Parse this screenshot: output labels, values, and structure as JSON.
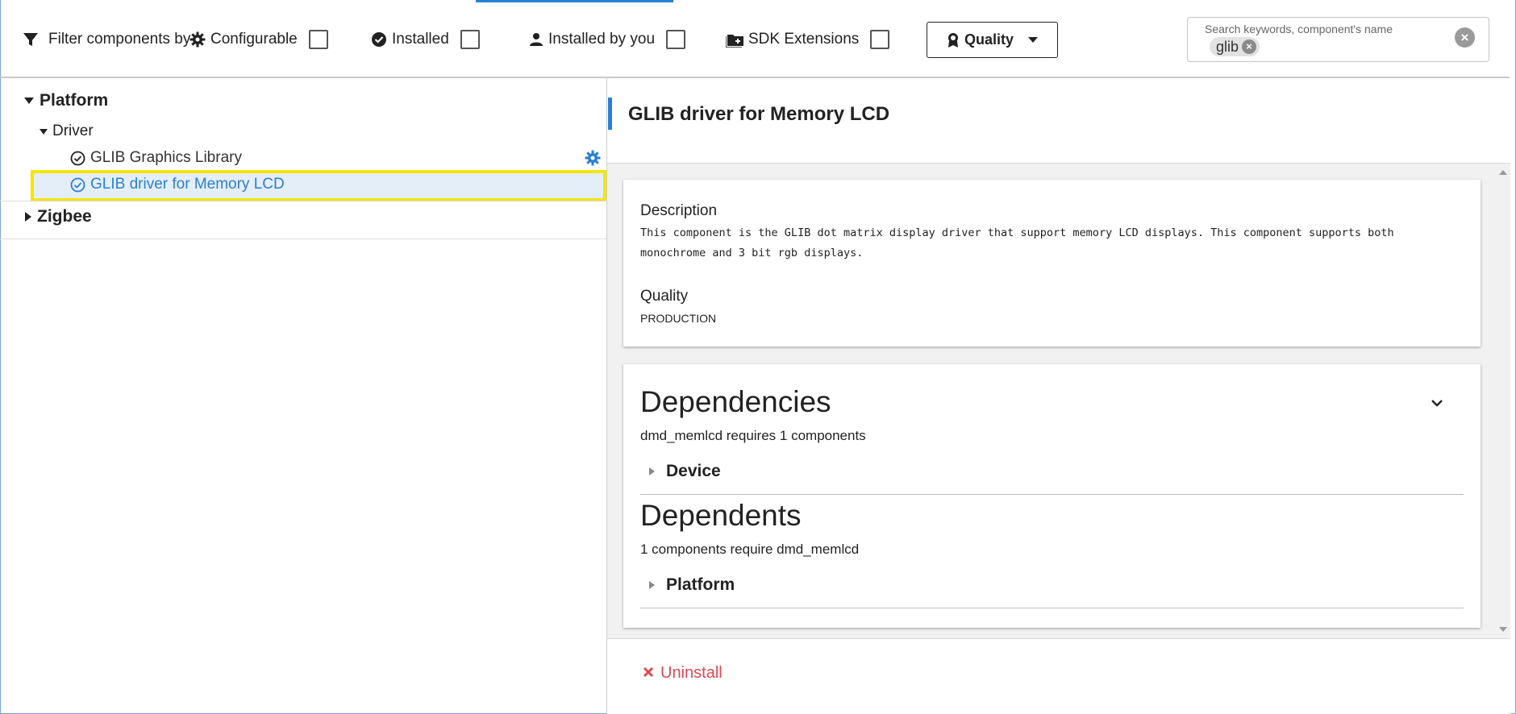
{
  "filter_bar": {
    "label": "Filter components by",
    "configurable": "Configurable",
    "installed": "Installed",
    "installed_by_you": "Installed by you",
    "sdk_extensions": "SDK Extensions",
    "quality_button": "Quality",
    "search": {
      "placeholder": "Search keywords, component's name",
      "chip": "glib"
    }
  },
  "tree": {
    "platform": "Platform",
    "driver": "Driver",
    "items": [
      {
        "label": "GLIB Graphics Library"
      },
      {
        "label": "GLIB driver for Memory LCD"
      }
    ],
    "zigbee": "Zigbee"
  },
  "detail": {
    "title": "GLIB driver for Memory LCD",
    "description_label": "Description",
    "description_line1": "This component is the GLIB dot matrix display driver that support memory LCD displays. This component supports both",
    "description_line2": "monochrome and 3 bit rgb displays.",
    "quality_label": "Quality",
    "quality_value": "PRODUCTION",
    "dependencies_heading": "Dependencies",
    "dependencies_text": "dmd_memlcd requires 1 components",
    "dependencies_group": "Device",
    "dependents_heading": "Dependents",
    "dependents_text": "1 components require dmd_memlcd",
    "dependents_group": "Platform",
    "uninstall_label": "Uninstall"
  },
  "colors": {
    "accent": "#2c7fd1",
    "selection_highlight": "#f5e500",
    "selected_text": "#2c7fd1",
    "uninstall": "#e0484f"
  }
}
